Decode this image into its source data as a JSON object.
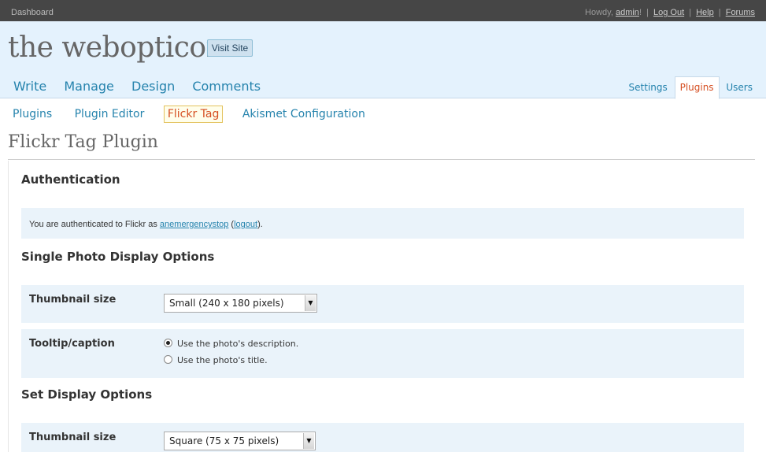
{
  "topbar": {
    "dashboard_label": "Dashboard",
    "howdy": "Howdy,",
    "user": "admin",
    "bang": "!",
    "logout": "Log Out",
    "help": "Help",
    "forums": "Forums"
  },
  "header": {
    "site_title": "the webopticon",
    "visit_site": "Visit Site"
  },
  "main_nav": [
    "Write",
    "Manage",
    "Design",
    "Comments"
  ],
  "side_nav": [
    {
      "label": "Settings",
      "active": false
    },
    {
      "label": "Plugins",
      "active": true
    },
    {
      "label": "Users",
      "active": false
    }
  ],
  "sub_nav": [
    {
      "label": "Plugins",
      "active": false
    },
    {
      "label": "Plugin Editor",
      "active": false
    },
    {
      "label": "Flickr Tag",
      "active": true
    },
    {
      "label": "Akismet Configuration",
      "active": false
    }
  ],
  "page_title": "Flickr Tag Plugin",
  "auth": {
    "heading": "Authentication",
    "text_pre": "You are authenticated to Flickr as",
    "username": "anemergencystop",
    "logout": "logout",
    "text_post": ")."
  },
  "single": {
    "heading": "Single Photo Display Options",
    "thumb_label": "Thumbnail size",
    "thumb_value": "Small (240 x 180 pixels)",
    "tooltip_label": "Tooltip/caption",
    "option_description": "Use the photo's description.",
    "option_title": "Use the photo's title."
  },
  "set": {
    "heading": "Set Display Options",
    "thumb_label": "Thumbnail size",
    "thumb_value": "Square (75 x 75 pixels)"
  },
  "colors": {
    "topbar_bg": "#464646",
    "header_bg": "#e4f2fd",
    "link": "#2583ad",
    "active": "#d54e21",
    "panel_bg": "#eaf3fa"
  }
}
